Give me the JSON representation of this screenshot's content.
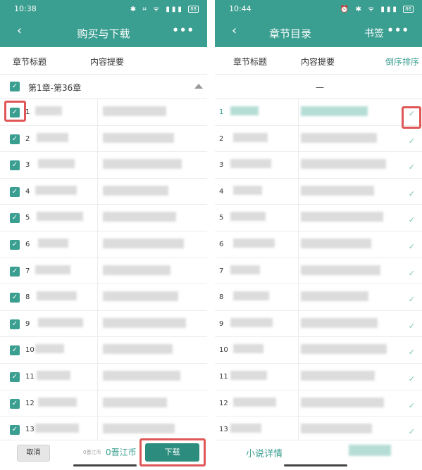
{
  "left": {
    "status": {
      "time": "10:38",
      "icons": "✱ ⌗ ᯤ ▮▮▮",
      "battery": "88"
    },
    "title": "购买与下载",
    "col_chapter": "章节标题",
    "col_summary": "内容提要",
    "group_label": "第1章-第36章",
    "rows": [
      "1",
      "2",
      "3",
      "4",
      "5",
      "6",
      "7",
      "8",
      "9",
      "10",
      "11",
      "12",
      "13"
    ],
    "cancel": "取消",
    "price_old": "0晋江币",
    "price": "0晋江币",
    "download": "下载"
  },
  "right": {
    "status": {
      "time": "10:44",
      "icons": "⏰ ✱ ᯤ ▮▮▮",
      "battery": "86"
    },
    "title": "章节目录",
    "bookmark": "书签",
    "col_chapter": "章节标题",
    "col_summary": "内容提要",
    "sort": "倒序排序",
    "group_label": "一",
    "rows": [
      "1",
      "2",
      "3",
      "4",
      "5",
      "6",
      "7",
      "8",
      "9",
      "10",
      "11",
      "12",
      "13"
    ],
    "detail": "小说详情"
  },
  "icons": {
    "back": "‹",
    "more": "•••",
    "check": "✓"
  },
  "colors": {
    "accent": "#3a9e90",
    "highlight": "#e05757"
  }
}
